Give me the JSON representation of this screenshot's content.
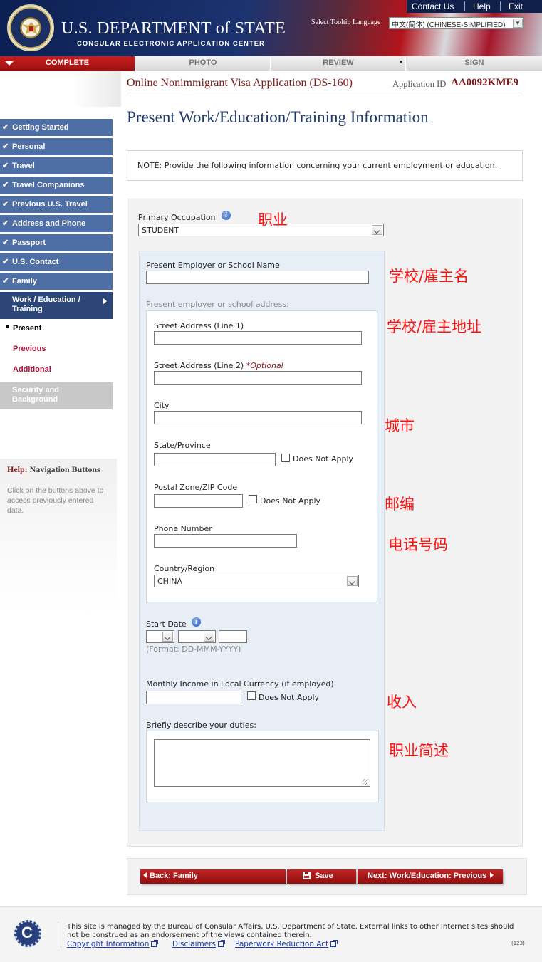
{
  "header": {
    "links": [
      "Contact Us",
      "Help",
      "Exit"
    ],
    "dept_title": "U.S. DEPARTMENT of STATE",
    "dept_subtitle": "CONSULAR ELECTRONIC APPLICATION CENTER",
    "tooltip_label": "Select Tooltip Language",
    "tooltip_value": "中文(简体) (CHINESE-SIMPLIFIED)"
  },
  "progress_tabs": [
    "COMPLETE",
    "PHOTO",
    "REVIEW",
    "SIGN"
  ],
  "app": {
    "title": "Online Nonimmigrant Visa Application (DS-160)",
    "id_label": "Application ID",
    "id_value": "AA0092KME9"
  },
  "page_title": "Present Work/Education/Training Information",
  "sidebar": {
    "items": [
      "Getting Started",
      "Personal",
      "Travel",
      "Travel Companions",
      "Previous U.S. Travel",
      "Address and Phone",
      "Passport",
      "U.S. Contact",
      "Family"
    ],
    "active": "Work / Education / Training",
    "sub_items": [
      "Present",
      "Previous",
      "Additional"
    ],
    "disabled": "Security and Background",
    "help_title_a": "Help:",
    "help_title_b": "Navigation Buttons",
    "help_text": "Click on the buttons above to access previously entered data."
  },
  "note": "NOTE: Provide the following information concerning your current employment or education.",
  "form": {
    "primary_occupation_label": "Primary Occupation",
    "primary_occupation_value": "STUDENT",
    "employer_label": "Present Employer or School Name",
    "employer_value": "",
    "address_heading": "Present employer or school address:",
    "street1_label": "Street Address (Line 1)",
    "street2_label": "Street Address (Line 2)",
    "street2_optional": "*Optional",
    "city_label": "City",
    "state_label": "State/Province",
    "postal_label": "Postal Zone/ZIP Code",
    "phone_label": "Phone Number",
    "country_label": "Country/Region",
    "country_value": "CHINA",
    "does_not_apply": "Does Not Apply",
    "start_date_label": "Start Date",
    "date_format": "(Format: DD-MMM-YYYY)",
    "income_label": "Monthly Income in Local Currency (if employed)",
    "duties_label": "Briefly describe your duties:"
  },
  "annotations": {
    "occupation": "职业",
    "employer": "学校/雇主名",
    "address": "学校/雇主地址",
    "city": "城市",
    "postal": "邮编",
    "phone": "电话号码",
    "income": "收入",
    "duties": "职业简述"
  },
  "buttons": {
    "back": "Back: Family",
    "save": "Save",
    "next": "Next: Work/Education: Previous"
  },
  "footer": {
    "text": "This site is managed by the Bureau of Consular Affairs, U.S. Department of State. External links to other Internet sites should not be construed as an endorsement of the views contained therein.",
    "links": [
      "Copyright Information",
      "Disclaimers",
      "Paperwork Reduction Act"
    ],
    "code": "(123)"
  },
  "colors": {
    "nav_blue": "#4e6ea6",
    "nav_active": "#2c4777",
    "accent_red": "#8f1010",
    "title_blue": "#213a69",
    "annotation_red": "#ff1010"
  }
}
